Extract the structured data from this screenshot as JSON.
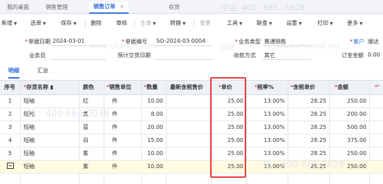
{
  "tabs": [
    {
      "label": "我的桌面"
    },
    {
      "label": "销售管理"
    },
    {
      "label": "销售订单",
      "active": true,
      "close": "×"
    },
    {
      "label": "存货"
    }
  ],
  "toolbar": {
    "new": "新增",
    "copy_from": "选单",
    "save": "保存",
    "delete": "删除",
    "audit": "审核",
    "generate": "生单",
    "convert": "转换",
    "change": "变更",
    "tools": "工具",
    "link": "联查",
    "settings": "设置",
    "print": "打印",
    "more": "更多",
    "watermark": "中话: 400 - 665 - 0828"
  },
  "form": {
    "doc_date_label": "单据日期",
    "doc_date": "2024-03-01",
    "doc_no_label": "单据编号",
    "doc_no": "SO-2024-03-0004",
    "biz_type_label": "业务类型",
    "biz_type": "普通销售",
    "customer_label": "客户",
    "customer": "顺达",
    "salesman_label": "业务员",
    "delivery_date_label": "预计交货日期",
    "payment_label": "收款方式",
    "payment": "其它",
    "deposit_label": "订金金额",
    "deposit": "0.00"
  },
  "watermarks": {
    "left": "www.chanjet.com",
    "right": "www.chanjet.net",
    "grid_left": "话：400-666-0038",
    "grid_right": "话：400-665-0828",
    "net": "网址"
  },
  "subtabs": {
    "detail": "明细",
    "summary": "汇总"
  },
  "grid": {
    "headers": {
      "seq": "序号",
      "item": "存货名称",
      "color": "颜色",
      "unit": "销售单位",
      "qty": "数量",
      "latest_price": "最新含税售价",
      "price": "单价",
      "tax_rate": "税率%",
      "tax_price": "含税单价",
      "amount": "金额",
      "extra": "'"
    },
    "rows": [
      {
        "seq": "1",
        "item": "短袖",
        "color": "红",
        "unit": "件",
        "qty": "10.00",
        "price": "25.00",
        "tax_rate": "13.00%",
        "tax_price": "28.25",
        "amount": "250.00"
      },
      {
        "seq": "2",
        "item": "短袖",
        "color": "黄",
        "unit": "件",
        "qty": "8.00",
        "price": "25.00",
        "tax_rate": "13.00%",
        "tax_price": "28.25",
        "amount": "200.00"
      },
      {
        "seq": "3",
        "item": "短袖",
        "color": "蓝",
        "unit": "件",
        "qty": "20.00",
        "price": "25.00",
        "tax_rate": "13.00%",
        "tax_price": "28.25",
        "amount": "500.00"
      },
      {
        "seq": "4",
        "item": "短袖",
        "color": "白",
        "unit": "件",
        "qty": "15.00",
        "price": "25.00",
        "tax_rate": "13.00%",
        "tax_price": "28.25",
        "amount": "375.00"
      },
      {
        "seq": "5",
        "item": "短袖",
        "color": "紫",
        "unit": "件",
        "qty": "10.00",
        "price": "25.00",
        "tax_rate": "13.00%",
        "tax_price": "28.25",
        "amount": "250.00"
      },
      {
        "seq": "",
        "item": "短袖",
        "color": "紫",
        "unit": "件",
        "qty": "10.00",
        "price": "25.00",
        "tax_rate": "13.00%",
        "tax_price": "28.25",
        "amount": "250.00"
      }
    ]
  },
  "colors": {
    "accent": "#2d6bd6",
    "highlight_box": "#e53935",
    "selected_row": "#fffbe0",
    "required": "#e02020"
  }
}
